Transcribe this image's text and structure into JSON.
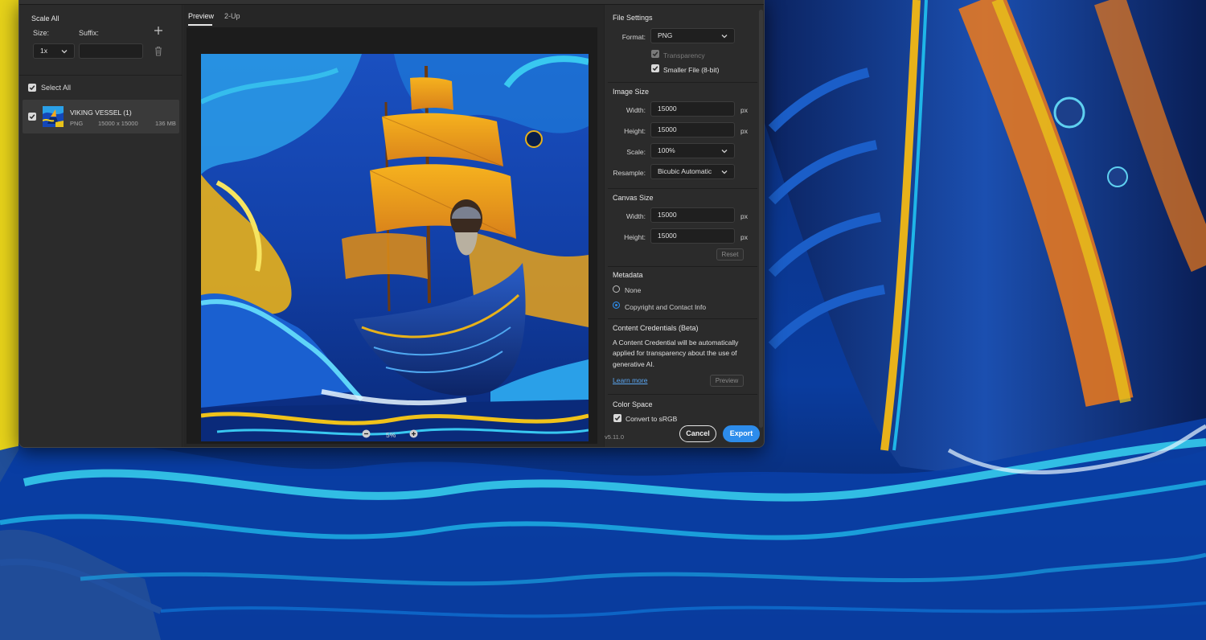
{
  "left_panel": {
    "scale_all_label": "Scale All",
    "size_label": "Size:",
    "suffix_label": "Suffix:",
    "size_value": "1x",
    "suffix_placeholder": "",
    "select_all_label": "Select All",
    "asset": {
      "name": "VIKING VESSEL (1)",
      "format": "PNG",
      "dimensions": "15000 x 15000",
      "file_size": "136 MB"
    }
  },
  "center": {
    "tabs": [
      "Preview",
      "2-Up"
    ],
    "zoom_level": "5%"
  },
  "file_settings": {
    "header": "File Settings",
    "format_label": "Format:",
    "format_value": "PNG",
    "transparency_label": "Transparency",
    "smaller_file_label": "Smaller File (8-bit)"
  },
  "image_size": {
    "header": "Image Size",
    "width_label": "Width:",
    "width_value": "15000",
    "height_label": "Height:",
    "height_value": "15000",
    "unit": "px",
    "scale_label": "Scale:",
    "scale_value": "100%",
    "resample_label": "Resample:",
    "resample_value": "Bicubic Automatic"
  },
  "canvas_size": {
    "header": "Canvas Size",
    "width_label": "Width:",
    "width_value": "15000",
    "height_label": "Height:",
    "height_value": "15000",
    "unit": "px",
    "reset_label": "Reset"
  },
  "metadata": {
    "header": "Metadata",
    "option_none": "None",
    "option_copyright": "Copyright and Contact Info"
  },
  "content_credentials": {
    "header": "Content Credentials (Beta)",
    "description": "A Content Credential will be automatically applied for transparency about the use of generative AI.",
    "learn_more": "Learn more",
    "preview_button": "Preview"
  },
  "color_space": {
    "header": "Color Space",
    "convert_label": "Convert to sRGB"
  },
  "footer": {
    "version": "v5.11.0",
    "cancel_label": "Cancel",
    "export_label": "Export"
  },
  "colors": {
    "accent": "#2d8ceb",
    "panel": "#2b2b2b",
    "preview_bg": "#1c1c1c"
  }
}
